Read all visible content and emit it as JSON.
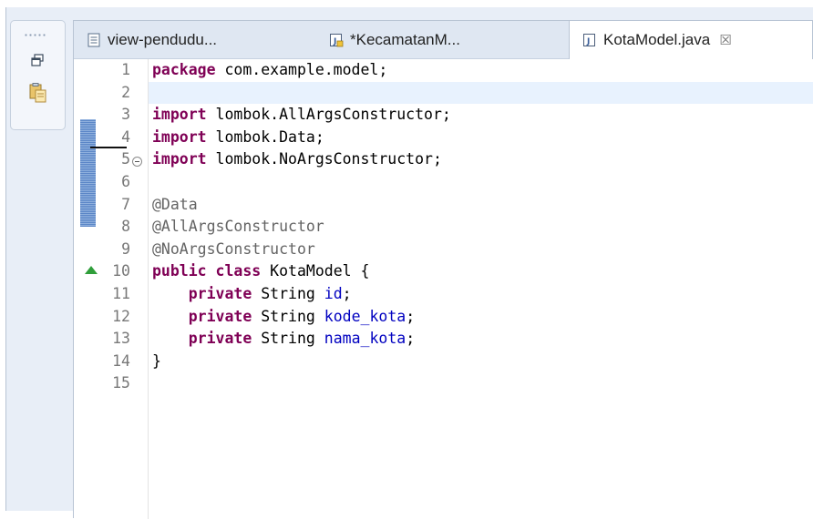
{
  "tabs": [
    {
      "label": "view-pendudu...",
      "icon": "html-file-icon",
      "active": false
    },
    {
      "label": "*KecamatanM...",
      "icon": "java-file-icon",
      "active": false
    },
    {
      "label": "KotaModel.java",
      "icon": "java-file-icon",
      "active": true,
      "close": "☒"
    }
  ],
  "trim": {
    "dots": "....."
  },
  "code": {
    "line_numbers": [
      "1",
      "2",
      "3",
      "4",
      "5",
      "6",
      "7",
      "8",
      "9",
      "10",
      "11",
      "12",
      "13",
      "14",
      "15"
    ],
    "lines": [
      [
        {
          "t": "package",
          "c": "kw"
        },
        {
          "t": " com.example.model;",
          "c": "plain"
        }
      ],
      [],
      [
        {
          "t": "import",
          "c": "kw"
        },
        {
          "t": " lombok.AllArgsConstructor;",
          "c": "plain"
        }
      ],
      [
        {
          "t": "import",
          "c": "kw"
        },
        {
          "t": " lombok.Data;",
          "c": "plain"
        }
      ],
      [
        {
          "t": "import",
          "c": "kw"
        },
        {
          "t": " lombok.NoArgsConstructor;",
          "c": "plain"
        }
      ],
      [],
      [
        {
          "t": "@Data",
          "c": "ann"
        }
      ],
      [
        {
          "t": "@AllArgsConstructor",
          "c": "ann"
        }
      ],
      [
        {
          "t": "@NoArgsConstructor",
          "c": "ann"
        }
      ],
      [
        {
          "t": "public",
          "c": "kw"
        },
        {
          "t": " ",
          "c": "plain"
        },
        {
          "t": "class",
          "c": "kw"
        },
        {
          "t": " KotaModel {",
          "c": "plain"
        }
      ],
      [
        {
          "t": "    ",
          "c": "plain"
        },
        {
          "t": "private",
          "c": "kw"
        },
        {
          "t": " String ",
          "c": "plain"
        },
        {
          "t": "id",
          "c": "fld"
        },
        {
          "t": ";",
          "c": "plain"
        }
      ],
      [
        {
          "t": "    ",
          "c": "plain"
        },
        {
          "t": "private",
          "c": "kw"
        },
        {
          "t": " String ",
          "c": "plain"
        },
        {
          "t": "kode_kota",
          "c": "fld"
        },
        {
          "t": ";",
          "c": "plain"
        }
      ],
      [
        {
          "t": "    ",
          "c": "plain"
        },
        {
          "t": "private",
          "c": "kw"
        },
        {
          "t": " String ",
          "c": "plain"
        },
        {
          "t": "nama_kota",
          "c": "fld"
        },
        {
          "t": ";",
          "c": "plain"
        }
      ],
      [
        {
          "t": "}",
          "c": "plain"
        }
      ],
      []
    ],
    "current_line": 2
  },
  "colors": {
    "keyword": "#7f0055",
    "annotation": "#646464",
    "field": "#0000c0",
    "line_number": "#787878",
    "current_line": "#e8f2fe"
  }
}
